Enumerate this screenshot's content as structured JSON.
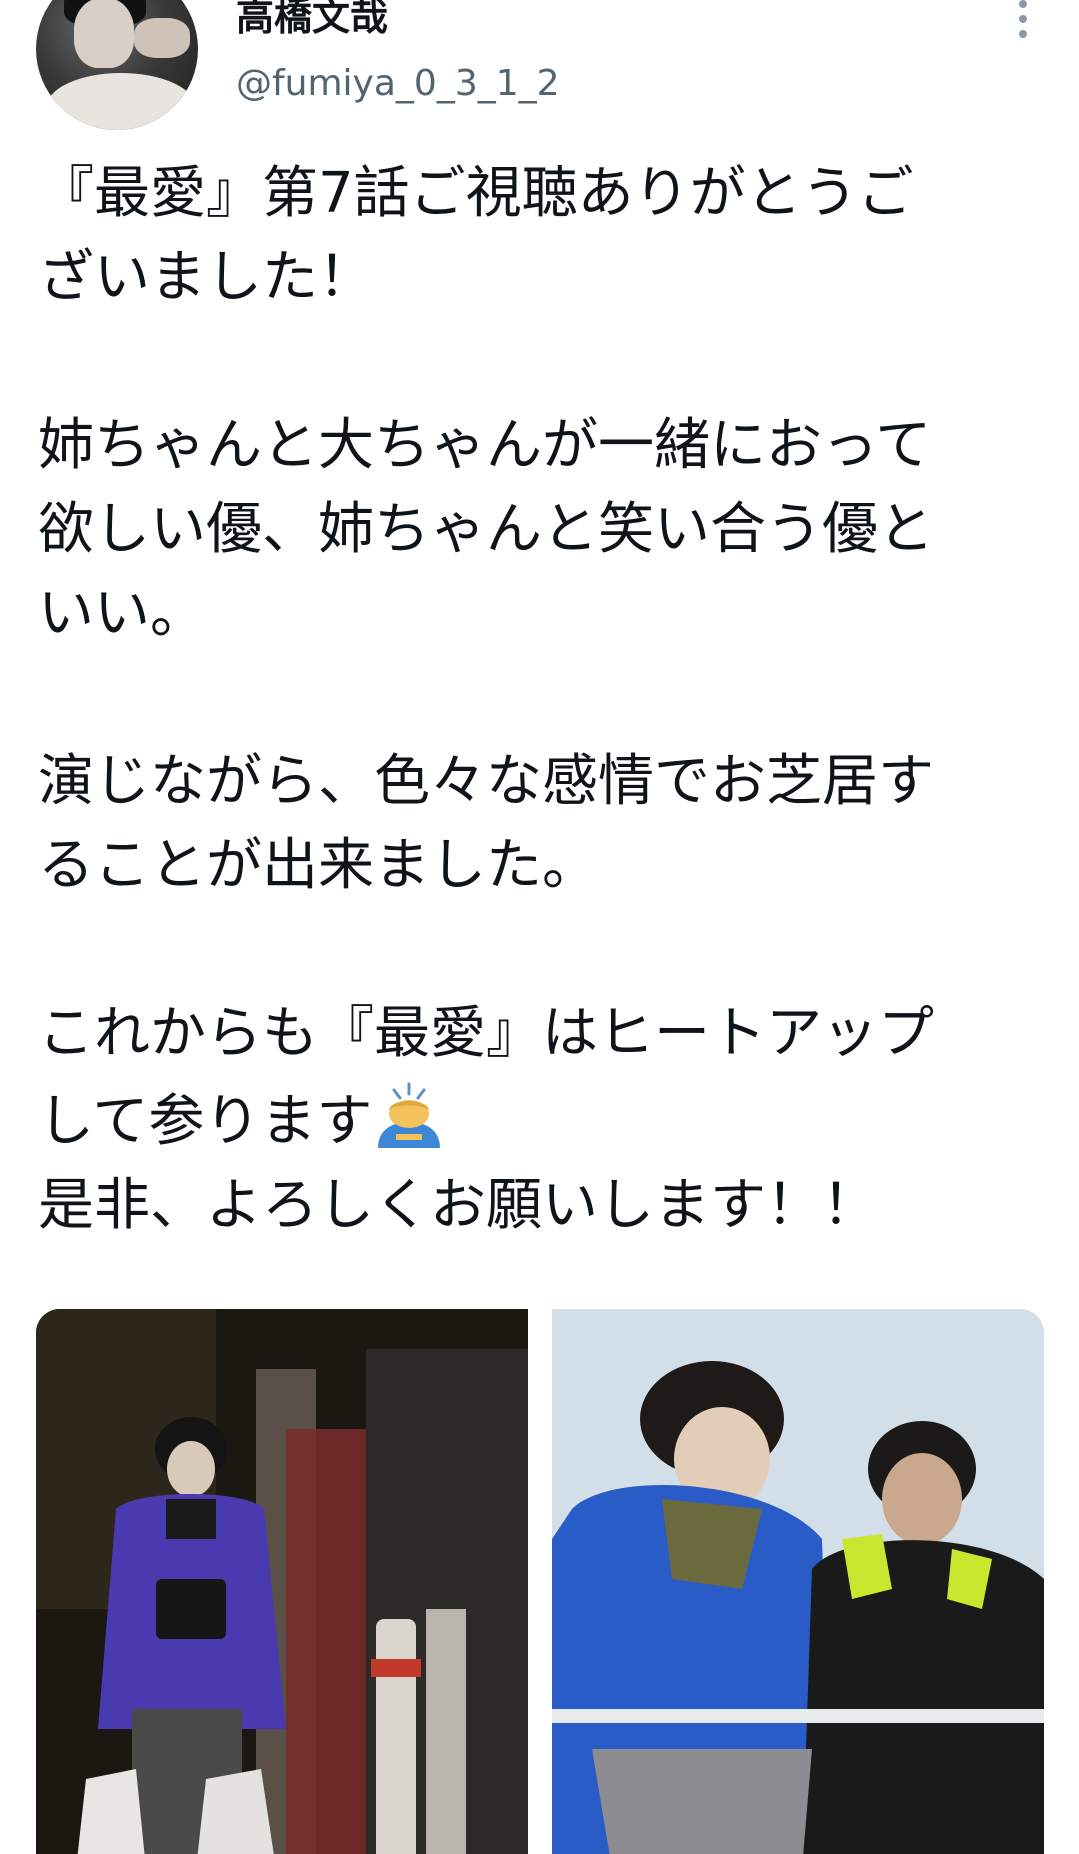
{
  "author": {
    "display_name": "高橋文哉",
    "handle": "@fumiya_0_3_1_2"
  },
  "icons": {
    "more": "more-vertical-icon",
    "emoji": "man-bowing-emoji"
  },
  "tweet": {
    "paragraphs": [
      [
        "『最愛』第7話ご視聴ありがとうご",
        "ざいました！"
      ],
      [
        "姉ちゃんと大ちゃんが一緒におって",
        "欲しい優、姉ちゃんと笑い合う優と",
        "いい。"
      ],
      [
        "演じながら、色々な感情でお芝居す",
        "ることが出来ました。"
      ],
      [
        "これからも『最愛』はヒートアップ",
        "して参ります",
        "是非、よろしくお願いします！！"
      ]
    ]
  },
  "colors": {
    "text": "#0f1419",
    "secondary": "#536471"
  }
}
